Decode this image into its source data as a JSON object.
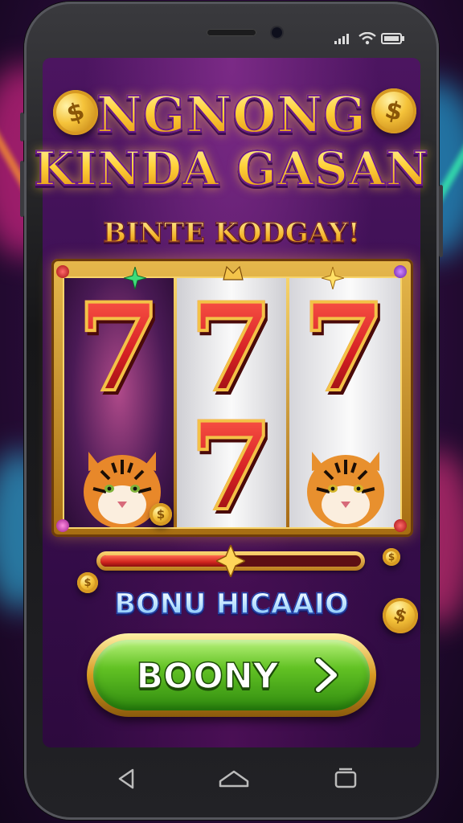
{
  "status_bar": {
    "icons": [
      "signal-icon",
      "wifi-icon",
      "battery-icon"
    ]
  },
  "game": {
    "title_line1": "NGNONG",
    "title_line2": "KINDA GASAN",
    "subtitle": "BINTE KODGAY!",
    "reels": [
      {
        "symbols": [
          "7",
          "tiger"
        ]
      },
      {
        "symbols": [
          "7",
          "7"
        ]
      },
      {
        "symbols": [
          "7",
          "tiger"
        ]
      }
    ],
    "progress": 0.5,
    "bonus_label": "BONU HICAAIO",
    "cta_label": "BOONY",
    "cta_icon": "chevron-right-icon"
  },
  "nav_bar": {
    "icons": [
      "back-icon",
      "home-icon",
      "recents-icon"
    ]
  },
  "colors": {
    "gold": "#ffd23a",
    "purple": "#4c1560",
    "seven_red": "#d41f23",
    "cta_green": "#62c224"
  }
}
